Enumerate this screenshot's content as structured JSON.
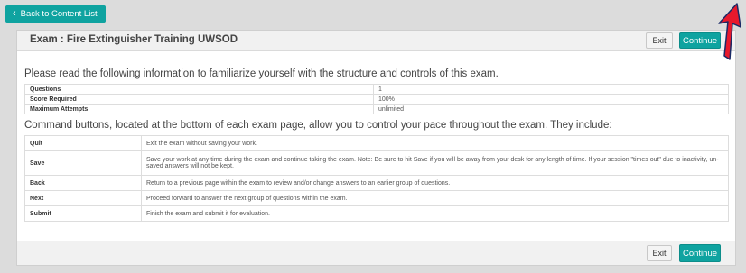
{
  "nav": {
    "back_label": "Back to Content List"
  },
  "header": {
    "title": "Exam : Fire Extinguisher Training UWSOD",
    "exit_label": "Exit",
    "continue_label": "Continue"
  },
  "intro_text": "Please read the following information to familiarize yourself with the structure and controls of this exam.",
  "info": [
    {
      "label": "Questions",
      "value": "1"
    },
    {
      "label": "Score Required",
      "value": "100%"
    },
    {
      "label": "Maximum Attempts",
      "value": "unlimited"
    }
  ],
  "commands_intro": "Command buttons, located at the bottom of each exam page, allow you to control your pace throughout the exam. They include:",
  "commands": [
    {
      "name": "Quit",
      "description": "Exit the exam without saving your work."
    },
    {
      "name": "Save",
      "description": "Save your work at any time during the exam and continue taking the exam. Note: Be sure to hit Save if you will be away from your desk for any length of time. If your session \"times out\" due to inactivity, un-saved answers will not be kept."
    },
    {
      "name": "Back",
      "description": "Return to a previous page within the exam to review and/or change answers to an earlier group of questions."
    },
    {
      "name": "Next",
      "description": "Proceed forward to answer the next group of questions within the exam."
    },
    {
      "name": "Submit",
      "description": "Finish the exam and submit it for evaluation."
    }
  ],
  "footer": {
    "exit_label": "Exit",
    "continue_label": "Continue"
  },
  "colors": {
    "accent": "#0fa3a0",
    "arrow": "#e8192c",
    "background": "#dcdcdc"
  }
}
